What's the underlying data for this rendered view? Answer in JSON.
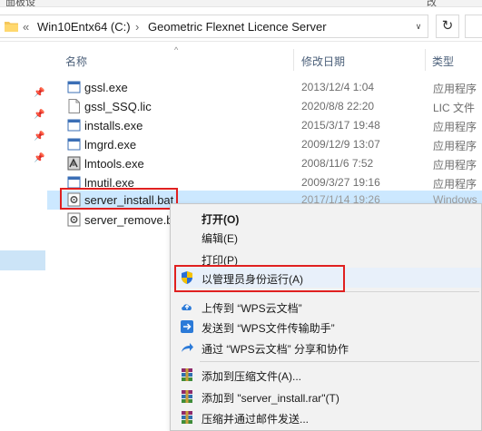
{
  "top_strip": {
    "left_text": "面板设",
    "right_text": "改"
  },
  "address": {
    "back_chevron": "«",
    "crumbs": [
      "Win10Entx64 (C:)",
      "Geometric Flexnet Licence Server"
    ],
    "separator": "›",
    "dropdown": "∨",
    "refresh": "↻"
  },
  "columns": {
    "name": "名称",
    "date": "修改日期",
    "type": "类型"
  },
  "files": [
    {
      "name": "gssl.exe",
      "date": "2013/12/4 1:04",
      "type": "应用程序",
      "icon": "exe-window-icon"
    },
    {
      "name": "gssl_SSQ.lic",
      "date": "2020/8/8 22:20",
      "type": "LIC 文件",
      "icon": "blank-file-icon"
    },
    {
      "name": "installs.exe",
      "date": "2015/3/17 19:48",
      "type": "应用程序",
      "icon": "exe-window-icon"
    },
    {
      "name": "lmgrd.exe",
      "date": "2009/12/9 13:07",
      "type": "应用程序",
      "icon": "exe-window-icon"
    },
    {
      "name": "lmtools.exe",
      "date": "2008/11/6 7:52",
      "type": "应用程序",
      "icon": "lmtools-icon"
    },
    {
      "name": "lmutil.exe",
      "date": "2009/3/27 19:16",
      "type": "应用程序",
      "icon": "exe-window-icon"
    },
    {
      "name": "server_install.bat",
      "date": "2017/1/14 19:26",
      "type": "Windows",
      "icon": "batch-gear-icon"
    },
    {
      "name": "server_remove.bat",
      "date": "",
      "type": "",
      "icon": "batch-gear-icon"
    }
  ],
  "context_menu": {
    "items": [
      {
        "label": "打开(O)",
        "icon": "",
        "bold": true
      },
      {
        "label": "编辑(E)",
        "icon": ""
      },
      {
        "label": "打印(P)",
        "icon": ""
      },
      {
        "label": "以管理员身份运行(A)",
        "icon": "uac-shield-icon"
      },
      {
        "label": "上传到 “WPS云文档”",
        "icon": "cloud-upload-icon"
      },
      {
        "label": "发送到 “WPS文件传输助手”",
        "icon": "send-arrow-icon"
      },
      {
        "label": "通过 “WPS云文档” 分享和协作",
        "icon": "share-icon"
      },
      {
        "label": "添加到压缩文件(A)...",
        "icon": "winrar-icon"
      },
      {
        "label": "添加到 \"server_install.rar\"(T)",
        "icon": "winrar-icon"
      },
      {
        "label": "压缩并通过邮件发送...",
        "icon": "winrar-icon"
      }
    ]
  },
  "colors": {
    "highlight_red": "#e02020",
    "selection_blue": "#cce8ff",
    "menu_bg": "#f2f2f2"
  }
}
